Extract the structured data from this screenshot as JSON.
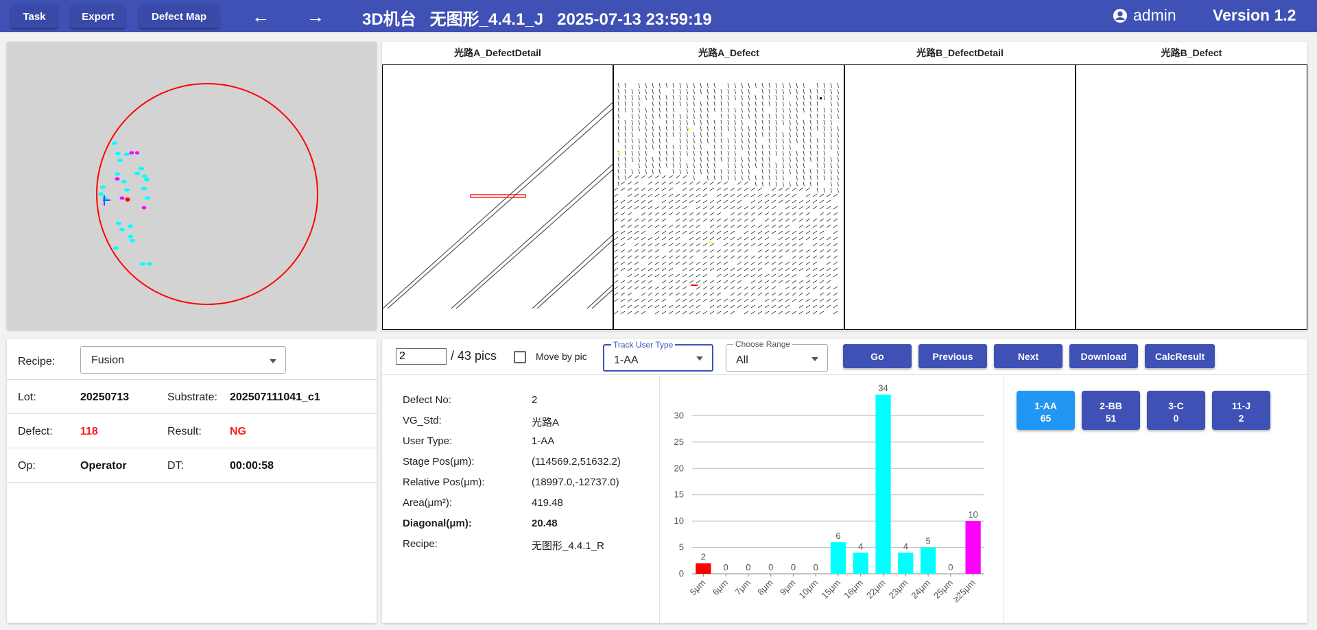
{
  "topbar": {
    "task_label": "Task",
    "export_label": "Export",
    "defect_map_label": "Defect Map",
    "title": "3D机台   无图形_4.4.1_J   2025-07-13 23:59:19",
    "user": "admin",
    "version": "Version 1.2",
    "bg_color": "#3f51b5"
  },
  "images": {
    "titles": [
      "光路A_DefectDetail",
      "光路A_Defect",
      "光路B_DefectDetail",
      "光路B_Defect"
    ]
  },
  "info": {
    "recipe_label": "Recipe:",
    "recipe_value": "Fusion",
    "lot_label": "Lot:",
    "lot_value": "20250713",
    "substrate_label": "Substrate:",
    "substrate_value": "202507111041_c1",
    "defect_label": "Defect:",
    "defect_value": "118",
    "result_label": "Result:",
    "result_value": "NG",
    "op_label": "Op:",
    "op_value": "Operator",
    "dt_label": "DT:",
    "dt_value": "00:00:58"
  },
  "controls": {
    "page_value": "2",
    "page_total": "/ 43 pics",
    "move_by_pic_label": "Move by pic",
    "track_user_type_legend": "Track User Type",
    "track_user_type_value": "1-AA",
    "choose_range_legend": "Choose Range",
    "choose_range_value": "All",
    "go_label": "Go",
    "previous_label": "Previous",
    "next_label": "Next",
    "download_label": "Download",
    "calc_label": "CalcResult"
  },
  "details": [
    {
      "label": "Defect No:",
      "value": "2"
    },
    {
      "label": "VG_Std:",
      "value": "光路A"
    },
    {
      "label": "User Type:",
      "value": "1-AA"
    },
    {
      "label": "Stage Pos(μm):",
      "value": "(114569.2,51632.2)"
    },
    {
      "label": "Relative Pos(μm):",
      "value": "(18997.0,-12737.0)"
    },
    {
      "label": "Area(μm²):",
      "value": "419.48"
    },
    {
      "label": "Diagonal(μm):",
      "value": "20.48"
    },
    {
      "label": "Recipe:",
      "value": "无图形_4.4.1_R"
    }
  ],
  "user_types": [
    {
      "name": "1-AA",
      "count": "65",
      "color": "#2196f3"
    },
    {
      "name": "2-BB",
      "count": "51",
      "color": "#3f51b5"
    },
    {
      "name": "3-C",
      "count": "0",
      "color": "#3f51b5"
    },
    {
      "name": "11-J",
      "count": "2",
      "color": "#3f51b5"
    }
  ],
  "chart_data": {
    "type": "bar",
    "categories": [
      "5μm",
      "6μm",
      "7μm",
      "8μm",
      "9μm",
      "10μm",
      "15μm",
      "16μm",
      "22μm",
      "23μm",
      "24μm",
      "25μm",
      "≥25μm"
    ],
    "values": [
      2,
      0,
      0,
      0,
      0,
      0,
      6,
      4,
      34,
      4,
      5,
      0,
      10
    ],
    "colors": [
      "#ff0000",
      "#00ffff",
      "#00ffff",
      "#00ffff",
      "#00ffff",
      "#00ffff",
      "#00ffff",
      "#00ffff",
      "#00ffff",
      "#00ffff",
      "#00ffff",
      "#00ffff",
      "#ff00ff"
    ],
    "yticks": [
      0,
      5,
      10,
      15,
      20,
      25,
      30
    ],
    "ylim": [
      0,
      35
    ],
    "grid": true
  }
}
